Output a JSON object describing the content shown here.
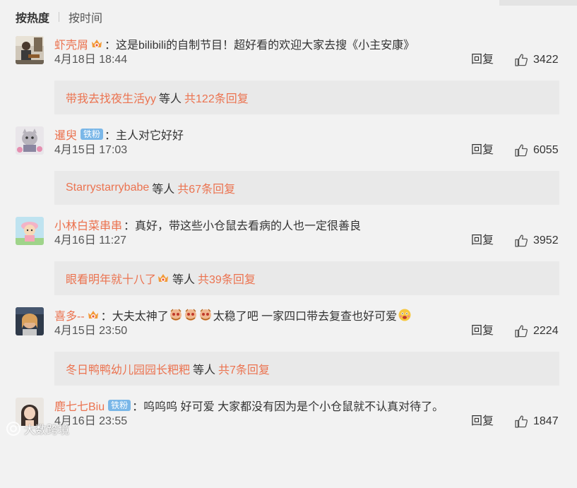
{
  "sort": {
    "hot_label": "按热度",
    "time_label": "按时间"
  },
  "comments": [
    {
      "username": "虾壳屑",
      "badge": "vip",
      "text": "这是bilibili的自制节目！超好看的欢迎大家去搜《小主安康》",
      "date": "4月18日 18:44",
      "reply_label": "回复",
      "likes": "3422",
      "reply_user": "带我去找夜生活yy",
      "reply_mid": "等人",
      "reply_total": "共122条回复"
    },
    {
      "username": "暹臾",
      "badge": "fan",
      "badge_text": "铁粉",
      "text": "主人对它好好",
      "date": "4月15日 17:03",
      "reply_label": "回复",
      "likes": "6055",
      "reply_user": "Starrystarrybabe",
      "reply_mid": "等人",
      "reply_total": "共67条回复"
    },
    {
      "username": "小林白菜串串",
      "badge": "none",
      "text": "真好，带这些小仓鼠去看病的人也一定很善良",
      "date": "4月16日 11:27",
      "reply_label": "回复",
      "likes": "3952",
      "reply_user": "眼看明年就十八了",
      "reply_mid": "等人",
      "reply_total": "共39条回复"
    },
    {
      "username": "喜多--",
      "badge": "vip",
      "text_a": "大夫太神了",
      "text_b": "太稳了吧 一家四口带去复查也好可爱",
      "date": "4月15日 23:50",
      "reply_label": "回复",
      "likes": "2224",
      "reply_user": "冬日鸭鸭幼儿园园长粑粑",
      "reply_mid": "等人",
      "reply_total": "共7条回复"
    },
    {
      "username": "鹿七七Biu",
      "badge": "fan",
      "badge_text": "铁粉",
      "text": "呜呜呜 好可爱 大家都没有因为是个小仓鼠就不认真对待了。",
      "date": "4月16日 23:55",
      "reply_label": "回复",
      "likes": "1847"
    }
  ],
  "watermark": "大数跨境",
  "colors": {
    "accent": "#eb7350",
    "fan_badge": "#7ab7e8",
    "background": "#f2f2f2",
    "reply_box": "#e9e9e9"
  }
}
